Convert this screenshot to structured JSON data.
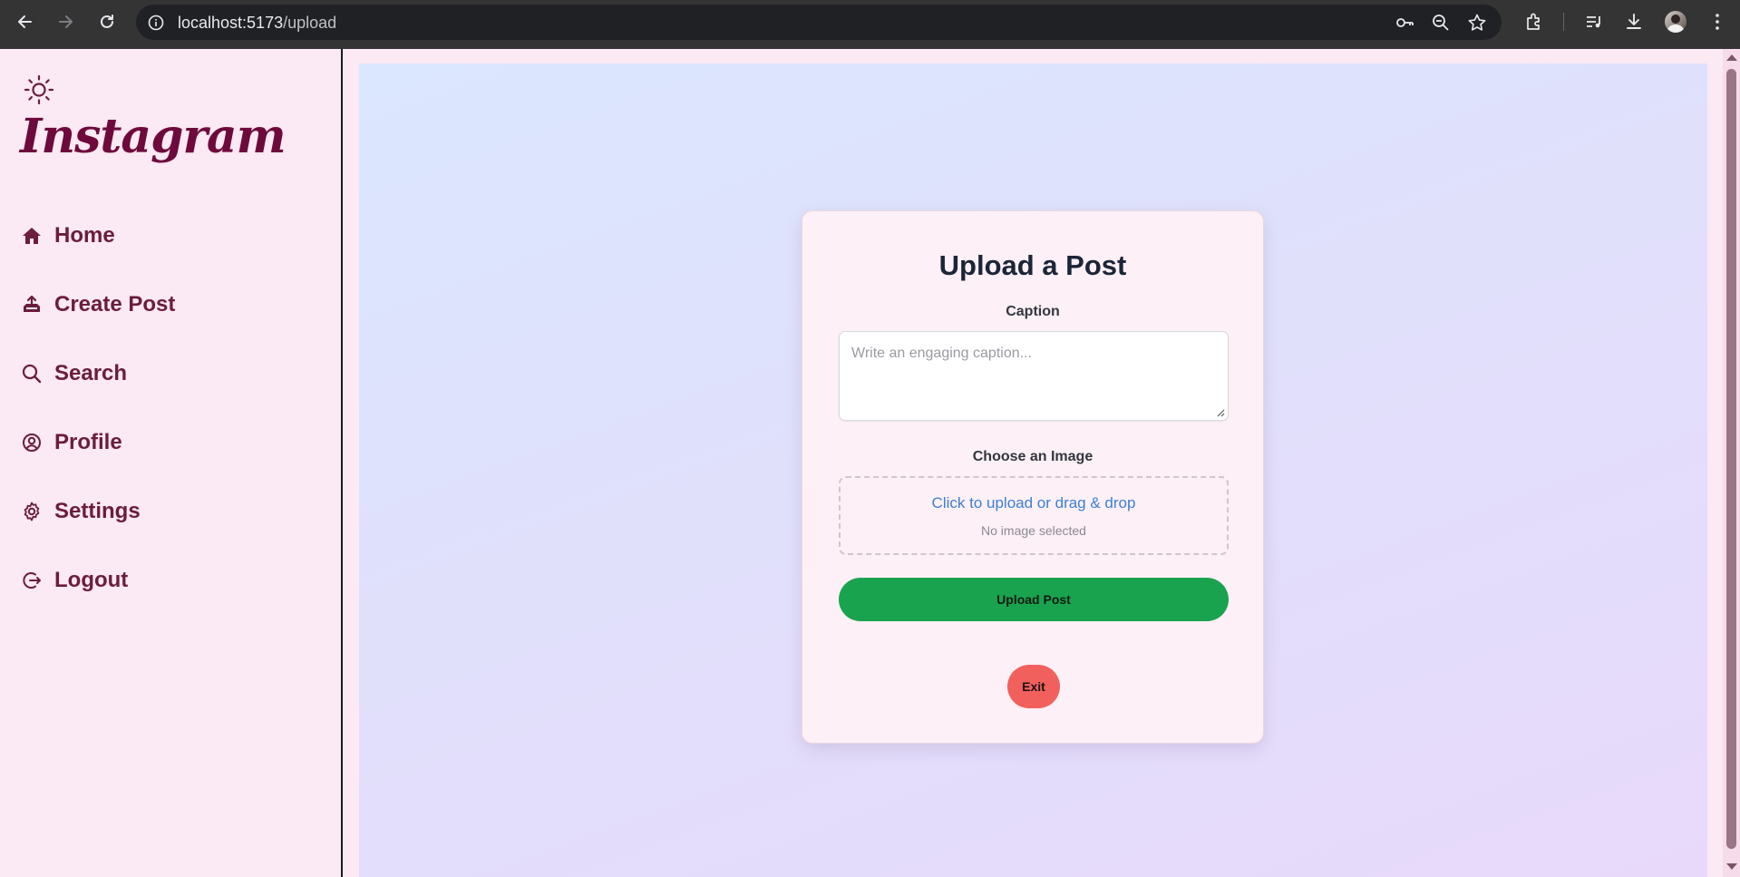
{
  "browser": {
    "url_host": "localhost:5173",
    "url_path": "/upload"
  },
  "sidebar": {
    "logo": "Instagram",
    "items": [
      {
        "label": "Home",
        "icon": "home-icon"
      },
      {
        "label": "Create Post",
        "icon": "upload-tray-icon"
      },
      {
        "label": "Search",
        "icon": "search-icon"
      },
      {
        "label": "Profile",
        "icon": "user-circle-icon"
      },
      {
        "label": "Settings",
        "icon": "gear-icon"
      },
      {
        "label": "Logout",
        "icon": "logout-icon"
      }
    ]
  },
  "upload": {
    "title": "Upload a Post",
    "caption_label": "Caption",
    "caption_placeholder": "Write an engaging caption...",
    "caption_value": "",
    "image_label": "Choose an Image",
    "dropzone_text": "Click to upload or drag & drop",
    "image_status": "No image selected",
    "submit_label": "Upload Post",
    "exit_label": "Exit"
  },
  "colors": {
    "brand": "#6e0a3b",
    "nav_text": "#6b1d3b",
    "submit": "#1aa34f",
    "exit": "#f1605d",
    "link": "#3d7fd4"
  }
}
